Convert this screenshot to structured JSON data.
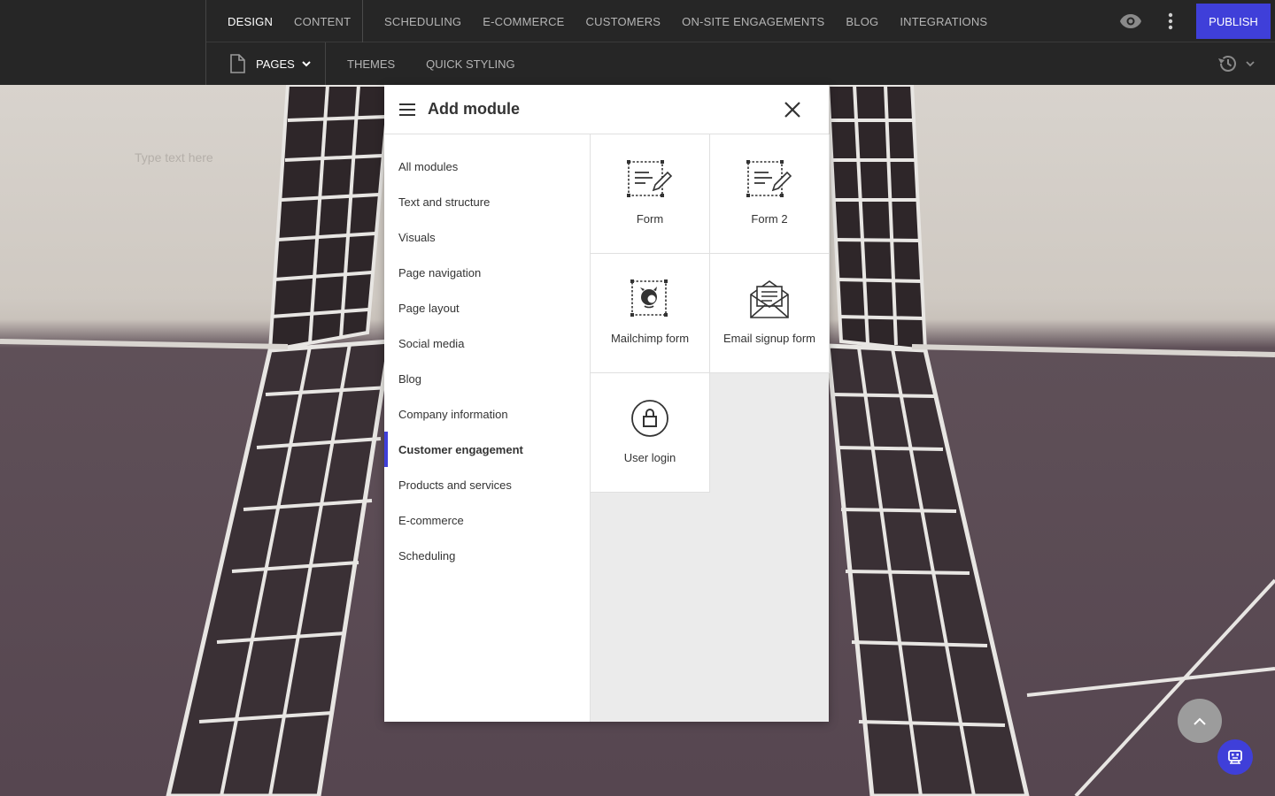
{
  "header": {
    "mode_tabs": [
      "DESIGN",
      "CONTENT"
    ],
    "main_tabs": [
      "SCHEDULING",
      "E-COMMERCE",
      "CUSTOMERS",
      "ON-SITE ENGAGEMENTS",
      "BLOG",
      "INTEGRATIONS"
    ],
    "publish_label": "PUBLISH"
  },
  "subheader": {
    "pages_label": "PAGES",
    "tabs": [
      "THEMES",
      "QUICK STYLING"
    ]
  },
  "canvas": {
    "placeholder": "Type text here"
  },
  "panel": {
    "title": "Add module",
    "categories": [
      "All modules",
      "Text and structure",
      "Visuals",
      "Page navigation",
      "Page layout",
      "Social media",
      "Blog",
      "Company information",
      "Customer engagement",
      "Products and services",
      "E-commerce",
      "Scheduling"
    ],
    "active_category": "Customer engagement",
    "modules": [
      {
        "label": "Form",
        "icon": "form-icon"
      },
      {
        "label": "Form 2",
        "icon": "form-icon"
      },
      {
        "label": "Mailchimp form",
        "icon": "mailchimp-icon"
      },
      {
        "label": "Email signup form",
        "icon": "envelope-icon"
      },
      {
        "label": "User login",
        "icon": "lock-icon"
      }
    ]
  },
  "colors": {
    "accent": "#3f3fd9",
    "topbar": "#262626"
  }
}
